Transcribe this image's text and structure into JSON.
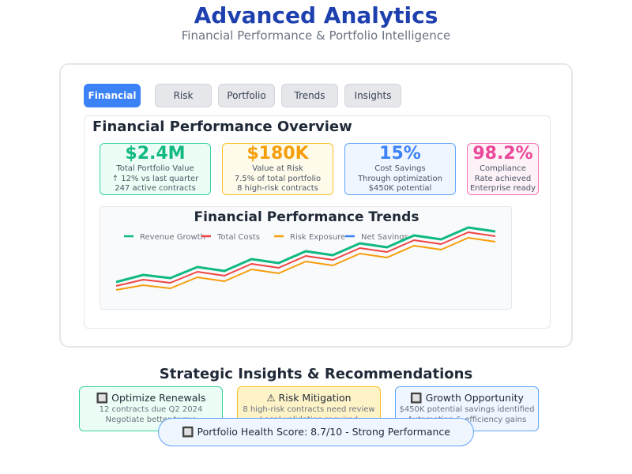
{
  "header": {
    "title": "Advanced Analytics",
    "subtitle": "Financial Performance & Portfolio Intelligence"
  },
  "tabs": [
    {
      "label": "Financial",
      "active": true
    },
    {
      "label": "Risk",
      "active": false
    },
    {
      "label": "Portfolio",
      "active": false
    },
    {
      "label": "Trends",
      "active": false
    },
    {
      "label": "Insights",
      "active": false
    }
  ],
  "panel": {
    "title": "Financial Performance Overview"
  },
  "metrics": [
    {
      "value": "$2.4M",
      "label": "Total Portfolio Value",
      "line2": "↑ 12% vs last quarter",
      "line3": "247 active contracts",
      "color": "#10b981",
      "bg": "#ecfdf5",
      "border": "#34d399"
    },
    {
      "value": "$180K",
      "label": "Value at Risk",
      "line2": "7.5% of total portfolio",
      "line3": "8 high-risk contracts",
      "color": "#f59e0b",
      "bg": "#fffbeb",
      "border": "#fbbf24"
    },
    {
      "value": "15%",
      "label": "Cost Savings",
      "line2": "Through optimization",
      "line3": "$450K potential",
      "color": "#3b82f6",
      "bg": "#eff6ff",
      "border": "#60a5fa"
    },
    {
      "value": "98.2%",
      "label": "Compliance",
      "line2": "Rate achieved",
      "line3": "Enterprise ready",
      "color": "#ec4899",
      "bg": "#fdf2f8",
      "border": "#f472b6"
    }
  ],
  "chart_data": {
    "type": "line",
    "title": "Financial Performance Trends",
    "legend_position": "top",
    "grid": false,
    "x": [
      1,
      2,
      3,
      4,
      5,
      6,
      7,
      8,
      9,
      10,
      11,
      12,
      13,
      14,
      15,
      16
    ],
    "ylim": [
      0,
      100
    ],
    "series": [
      {
        "name": "Revenue Growth",
        "color": "#10b981",
        "values": [
          0,
          9,
          5,
          19,
          14,
          29,
          24,
          39,
          34,
          49,
          44,
          59,
          54,
          69,
          64
        ]
      },
      {
        "name": "Total Costs",
        "color": "#ef4444",
        "values": [
          -5,
          3,
          -1,
          13,
          8,
          23,
          18,
          33,
          28,
          43,
          38,
          53,
          48,
          63,
          58
        ]
      },
      {
        "name": "Risk Exposure",
        "color": "#f59e0b",
        "values": [
          -10,
          -4,
          -8,
          6,
          1,
          16,
          11,
          26,
          21,
          36,
          31,
          46,
          41,
          56,
          51
        ]
      },
      {
        "name": "Net Savings",
        "color": "#3b82f6",
        "values": []
      }
    ]
  },
  "insights": {
    "title": "Strategic Insights & Recommendations",
    "cards": [
      {
        "heading": "🔲 Optimize Renewals",
        "line1": "12 contracts due Q2 2024",
        "line2": "Negotiate better terms",
        "bg": "#ecfdf5",
        "border": "#34d399"
      },
      {
        "heading": "⚠ Risk Mitigation",
        "line1": "8 high-risk contracts need review",
        "line2": "Legal validation required",
        "bg": "#fef3c7",
        "border": "#fbbf24"
      },
      {
        "heading": "🔲 Growth Opportunity",
        "line1": "$450K potential savings identified",
        "line2": "Automation & efficiency gains",
        "bg": "#eff6ff",
        "border": "#60a5fa"
      }
    ]
  },
  "health": {
    "text": "🔲 Portfolio Health Score: 8.7/10 - Strong Performance"
  }
}
